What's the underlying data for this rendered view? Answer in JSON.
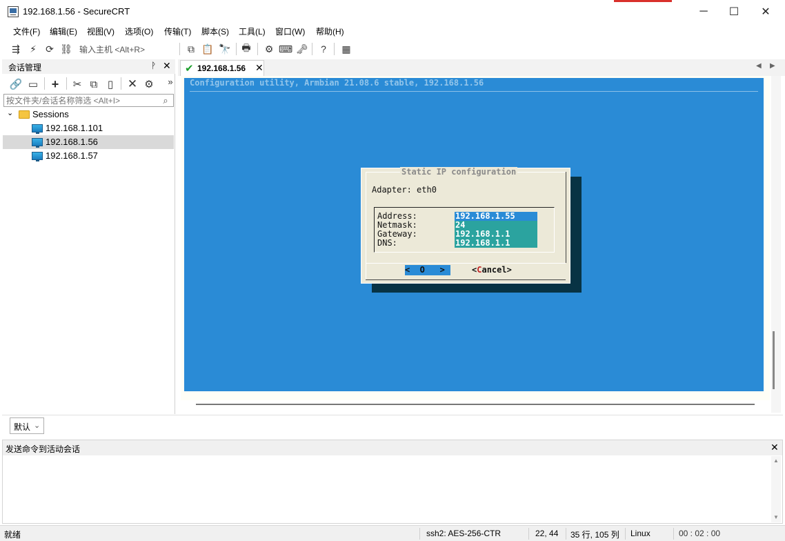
{
  "window": {
    "title": "192.168.1.56 - SecureCRT",
    "minimize": "─",
    "maximize": "☐",
    "close": "✕"
  },
  "menu": [
    "文件(F)",
    "编辑(E)",
    "视图(V)",
    "选项(O)",
    "传输(T)",
    "脚本(S)",
    "工具(L)",
    "窗口(W)",
    "帮助(H)"
  ],
  "toolbar": {
    "quick_connect": "输入主机 <Alt+R>"
  },
  "session_manager": {
    "title": "会话管理",
    "pin": "ᚹ",
    "close": "✕",
    "more": "»",
    "filter_placeholder": "按文件夹/会话名称筛选 <Alt+I>",
    "tree": {
      "root": "Sessions",
      "items": [
        "192.168.1.101",
        "192.168.1.56",
        "192.168.1.57"
      ],
      "selected": "192.168.1.56"
    }
  },
  "tabs": [
    {
      "label": "192.168.1.56",
      "connected": true
    }
  ],
  "terminal": {
    "header": "Configuration utility, Armbian 21.08.6 stable, 192.168.1.56",
    "dialog": {
      "title": "Static IP configuration",
      "adapter_line": "Adapter: eth0",
      "fields": [
        {
          "label": "Address:",
          "value": "192.168.1.55"
        },
        {
          "label": "Netmask:",
          "value": "24"
        },
        {
          "label": "Gateway:",
          "value": "192.168.1.1"
        },
        {
          "label": "DNS:",
          "value": "192.168.1.1"
        }
      ],
      "ok": "<  O   >",
      "cancel_pre": "<",
      "cancel_hot": "C",
      "cancel_post": "ancel>"
    }
  },
  "button_bar": {
    "selected": "默认"
  },
  "command_window": {
    "title": "发送命令到活动会话",
    "close": "✕"
  },
  "status": {
    "ready": "就绪",
    "cipher": "ssh2: AES-256-CTR",
    "cursor": "22,  44",
    "size": "35 行, 105 列",
    "term": "Linux",
    "extra": "00 : 02 : 00"
  },
  "colors": {
    "terminal_bg": "#2a8bd6",
    "dialog_bg": "#ece9d8",
    "field_selected": "#2a8bd6",
    "field_other": "#2ba39f",
    "connected": "#1a9e2a"
  }
}
